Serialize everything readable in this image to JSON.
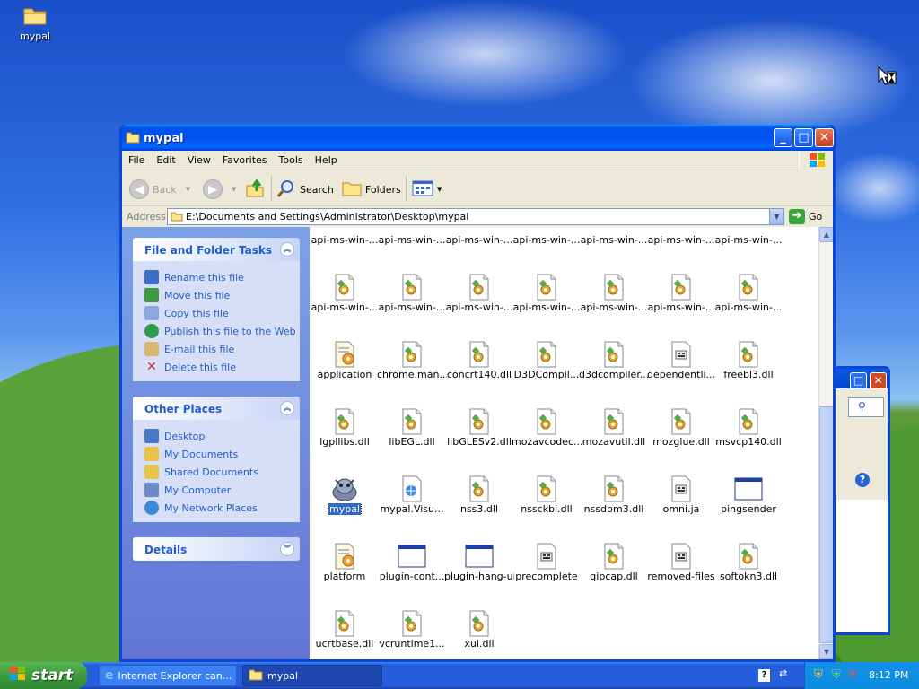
{
  "desktop": {
    "icons": [
      {
        "label": "mypal",
        "icon": "folder-icon"
      }
    ]
  },
  "window": {
    "title": "mypal",
    "icon": "folder-icon",
    "controls": {
      "minimize": "_",
      "maximize": "□",
      "close": "✕"
    },
    "menu": [
      "File",
      "Edit",
      "View",
      "Favorites",
      "Tools",
      "Help"
    ],
    "toolbar": {
      "back": "Back",
      "search": "Search",
      "folders": "Folders"
    },
    "address": {
      "label": "Address",
      "value": "E:\\Documents and Settings\\Administrator\\Desktop\\mypal",
      "go": "Go"
    }
  },
  "tasks": {
    "file_folder": {
      "title": "File and Folder Tasks",
      "items": [
        {
          "label": "Rename this file",
          "icon": "rename-icon",
          "color": "#3a6fc8"
        },
        {
          "label": "Move this file",
          "icon": "move-icon",
          "color": "#3e9a3e"
        },
        {
          "label": "Copy this file",
          "icon": "copy-icon",
          "color": "#8aa8e0"
        },
        {
          "label": "Publish this file to the Web",
          "icon": "globe-icon",
          "color": "#2e9a4a"
        },
        {
          "label": "E-mail this file",
          "icon": "email-icon",
          "color": "#d8b86a"
        },
        {
          "label": "Delete this file",
          "icon": "delete-icon",
          "color": "#d02828"
        }
      ]
    },
    "other_places": {
      "title": "Other Places",
      "items": [
        {
          "label": "Desktop",
          "icon": "desktop-icon",
          "color": "#4a78c8"
        },
        {
          "label": "My Documents",
          "icon": "my-documents-icon",
          "color": "#e9c24a"
        },
        {
          "label": "Shared Documents",
          "icon": "shared-documents-icon",
          "color": "#e9c24a"
        },
        {
          "label": "My Computer",
          "icon": "my-computer-icon",
          "color": "#6a8ac8"
        },
        {
          "label": "My Network Places",
          "icon": "network-places-icon",
          "color": "#3a8ad8"
        }
      ]
    },
    "details": {
      "title": "Details"
    }
  },
  "files": [
    {
      "label": "api-ms-win-...",
      "icon": "dll-icon"
    },
    {
      "label": "api-ms-win-...",
      "icon": "dll-icon"
    },
    {
      "label": "api-ms-win-...",
      "icon": "dll-icon"
    },
    {
      "label": "api-ms-win-...",
      "icon": "dll-icon"
    },
    {
      "label": "api-ms-win-...",
      "icon": "dll-icon"
    },
    {
      "label": "api-ms-win-...",
      "icon": "dll-icon"
    },
    {
      "label": "api-ms-win-...",
      "icon": "dll-icon"
    },
    {
      "label": "api-ms-win-...",
      "icon": "dll-icon"
    },
    {
      "label": "api-ms-win-...",
      "icon": "dll-icon"
    },
    {
      "label": "api-ms-win-...",
      "icon": "dll-icon"
    },
    {
      "label": "api-ms-win-...",
      "icon": "dll-icon"
    },
    {
      "label": "api-ms-win-...",
      "icon": "dll-icon"
    },
    {
      "label": "api-ms-win-...",
      "icon": "dll-icon"
    },
    {
      "label": "api-ms-win-...",
      "icon": "dll-icon"
    },
    {
      "label": "application",
      "icon": "config-icon"
    },
    {
      "label": "chrome.man...",
      "icon": "dll-icon"
    },
    {
      "label": "concrt140.dll",
      "icon": "dll-icon"
    },
    {
      "label": "D3DCompil...",
      "icon": "dll-icon"
    },
    {
      "label": "d3dcompiler...",
      "icon": "dll-icon"
    },
    {
      "label": "dependentli...",
      "icon": "text-file-icon"
    },
    {
      "label": "freebl3.dll",
      "icon": "dll-icon"
    },
    {
      "label": "lgpllibs.dll",
      "icon": "dll-icon"
    },
    {
      "label": "libEGL.dll",
      "icon": "dll-icon"
    },
    {
      "label": "libGLESv2.dll",
      "icon": "dll-icon"
    },
    {
      "label": "mozavcodec...",
      "icon": "dll-icon"
    },
    {
      "label": "mozavutil.dll",
      "icon": "dll-icon"
    },
    {
      "label": "mozglue.dll",
      "icon": "dll-icon"
    },
    {
      "label": "msvcp140.dll",
      "icon": "dll-icon"
    },
    {
      "label": "mypal",
      "icon": "mypal-app-icon",
      "selected": true
    },
    {
      "label": "mypal.Visu...",
      "icon": "web-file-icon"
    },
    {
      "label": "nss3.dll",
      "icon": "dll-icon"
    },
    {
      "label": "nssckbi.dll",
      "icon": "dll-icon"
    },
    {
      "label": "nssdbm3.dll",
      "icon": "dll-icon"
    },
    {
      "label": "omni.ja",
      "icon": "text-file-icon"
    },
    {
      "label": "pingsender",
      "icon": "app-window-icon"
    },
    {
      "label": "platform",
      "icon": "config-icon"
    },
    {
      "label": "plugin-cont...",
      "icon": "app-window-icon"
    },
    {
      "label": "plugin-hang-ui",
      "icon": "app-window-icon"
    },
    {
      "label": "precomplete",
      "icon": "text-file-icon"
    },
    {
      "label": "qipcap.dll",
      "icon": "dll-icon"
    },
    {
      "label": "removed-files",
      "icon": "text-file-icon"
    },
    {
      "label": "softokn3.dll",
      "icon": "dll-icon"
    },
    {
      "label": "ucrtbase.dll",
      "icon": "dll-icon"
    },
    {
      "label": "vcruntime1...",
      "icon": "dll-icon"
    },
    {
      "label": "xul.dll",
      "icon": "dll-icon"
    }
  ],
  "taskbar": {
    "start": "start",
    "items": [
      {
        "label": "Internet Explorer can...",
        "icon": "internet-explorer-icon"
      },
      {
        "label": "mypal",
        "icon": "folder-icon"
      }
    ],
    "clock": "8:12 PM"
  },
  "colors": {
    "xp_blue": "#0a46d8",
    "link_blue": "#215dc6",
    "selection": "#316ac5",
    "start_green": "#3c9a3c"
  }
}
